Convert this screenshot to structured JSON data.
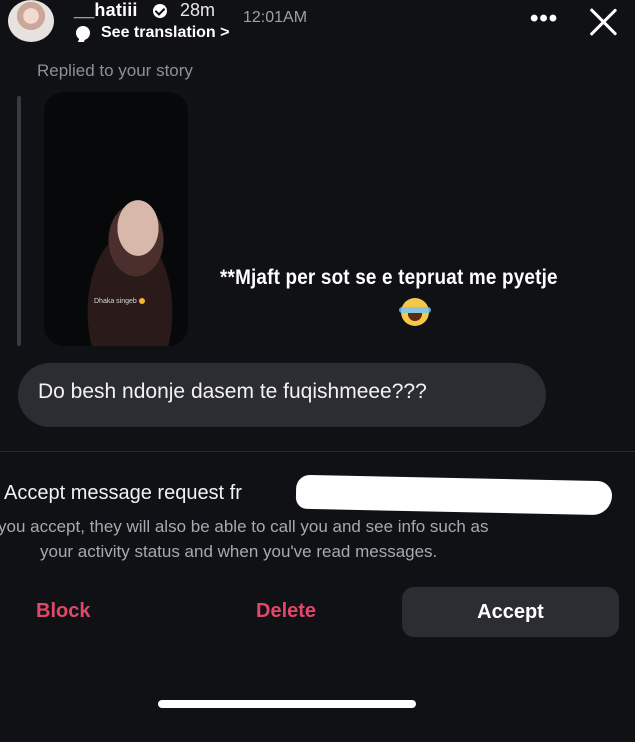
{
  "header": {
    "username": "__hatiii",
    "time_ago": "28m",
    "see_translation": "See translation >",
    "message_time": "12:01AM",
    "more_label": "•••"
  },
  "conversation": {
    "replied_label": "Replied to your story",
    "story_caption": "Dhaka singeb",
    "story_reply_text": "**Mjaft per sot se e tepruat me pyetje",
    "message_text": "Do besh ndonje dasem te fuqishmeee???"
  },
  "request": {
    "title": "Accept message request fr",
    "info_line1": "you accept, they will also be able to call you and see info such as",
    "info_line2": "your activity status and when you've read messages."
  },
  "actions": {
    "block_label": "Block",
    "delete_label": "Delete",
    "accept_label": "Accept"
  },
  "colors": {
    "background": "#101115",
    "bubble": "#2c2d33",
    "danger": "#e0486a"
  },
  "icons": [
    "verified-icon",
    "translate-icon",
    "more-icon",
    "close-icon",
    "laughing-emoji-icon"
  ]
}
